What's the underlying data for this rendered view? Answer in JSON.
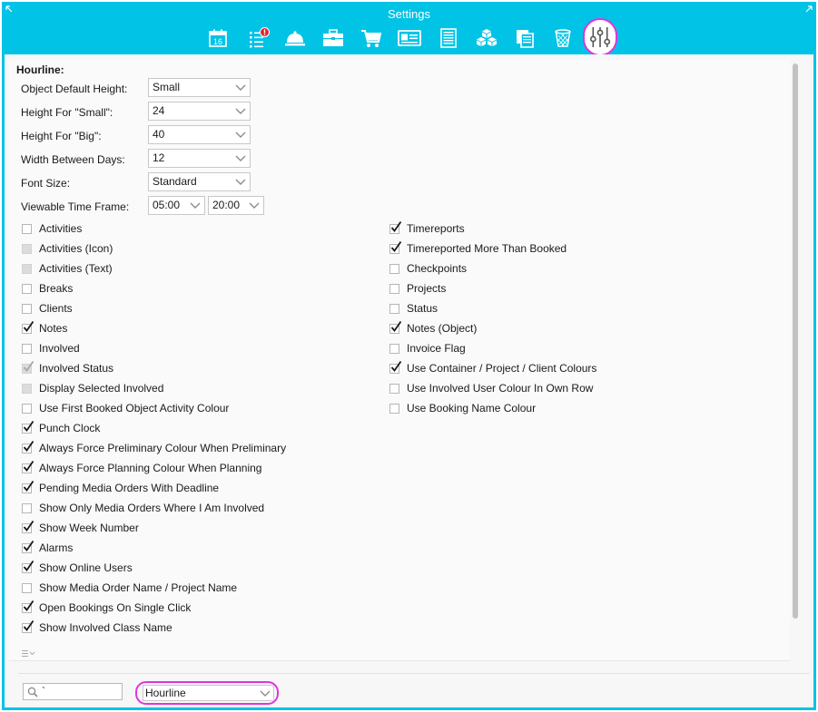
{
  "window": {
    "title": "Settings",
    "accent": "#00c3e6",
    "highlight": "#e333dd"
  },
  "toolbar": {
    "icons": [
      "calendar-icon",
      "task-list-alert-icon",
      "service-bell-icon",
      "briefcase-icon",
      "shopping-cart-icon",
      "id-card-icon",
      "document-lines-icon",
      "cubes-icon",
      "copy-pages-icon",
      "trash-icon",
      "sliders-icon"
    ],
    "calendar_day": "16",
    "selected": "sliders-icon"
  },
  "section": {
    "title": "Hourline:"
  },
  "fields": {
    "object_default_height": {
      "label": "Object Default Height:",
      "value": "Small"
    },
    "height_small": {
      "label": "Height For \"Small\":",
      "value": "24"
    },
    "height_big": {
      "label": "Height For \"Big\":",
      "value": "40"
    },
    "width_between_days": {
      "label": "Width Between Days:",
      "value": "12"
    },
    "font_size": {
      "label": "Font Size:",
      "value": "Standard"
    },
    "viewable_time_frame": {
      "label": "Viewable Time Frame:",
      "from": "05:00",
      "to": "20:00"
    }
  },
  "left_checks": [
    {
      "label": "Activities",
      "checked": false,
      "disabled": false
    },
    {
      "label": "Activities (Icon)",
      "checked": false,
      "disabled": true
    },
    {
      "label": "Activities (Text)",
      "checked": false,
      "disabled": true
    },
    {
      "label": "Breaks",
      "checked": false,
      "disabled": false
    },
    {
      "label": "Clients",
      "checked": false,
      "disabled": false
    },
    {
      "label": "Notes",
      "checked": true,
      "disabled": false
    },
    {
      "label": "Involved",
      "checked": false,
      "disabled": false
    },
    {
      "label": "Involved Status",
      "checked": true,
      "disabled": true
    },
    {
      "label": "Display Selected Involved",
      "checked": false,
      "disabled": true
    },
    {
      "label": "Use First Booked Object Activity Colour",
      "checked": false,
      "disabled": false
    },
    {
      "label": "Punch Clock",
      "checked": true,
      "disabled": false
    },
    {
      "label": "Always Force Preliminary Colour When Preliminary",
      "checked": true,
      "disabled": false
    },
    {
      "label": "Always Force Planning Colour When Planning",
      "checked": true,
      "disabled": false
    },
    {
      "label": "Pending Media Orders With Deadline",
      "checked": true,
      "disabled": false
    },
    {
      "label": "Show Only Media Orders Where I Am Involved",
      "checked": false,
      "disabled": false
    },
    {
      "label": "Show Week Number",
      "checked": true,
      "disabled": false
    },
    {
      "label": "Alarms",
      "checked": true,
      "disabled": false
    },
    {
      "label": "Show Online Users",
      "checked": true,
      "disabled": false
    },
    {
      "label": "Show Media Order Name / Project Name",
      "checked": false,
      "disabled": false
    },
    {
      "label": "Open Bookings On Single Click",
      "checked": true,
      "disabled": false
    },
    {
      "label": "Show Involved Class Name",
      "checked": true,
      "disabled": false
    }
  ],
  "right_checks": [
    {
      "label": "Timereports",
      "checked": true,
      "disabled": false
    },
    {
      "label": "Timereported More Than Booked",
      "checked": true,
      "disabled": false
    },
    {
      "label": "Checkpoints",
      "checked": false,
      "disabled": false
    },
    {
      "label": "Projects",
      "checked": false,
      "disabled": false
    },
    {
      "label": "Status",
      "checked": false,
      "disabled": false
    },
    {
      "label": "Notes (Object)",
      "checked": true,
      "disabled": false
    },
    {
      "label": "Invoice Flag",
      "checked": false,
      "disabled": false
    },
    {
      "label": "Use Container / Project / Client Colours",
      "checked": true,
      "disabled": false
    },
    {
      "label": "Use Involved User Colour  In Own Row",
      "checked": false,
      "disabled": false
    },
    {
      "label": "Use Booking Name Colour",
      "checked": false,
      "disabled": false
    }
  ],
  "footer": {
    "search_value": "`",
    "view_select": "Hourline"
  }
}
